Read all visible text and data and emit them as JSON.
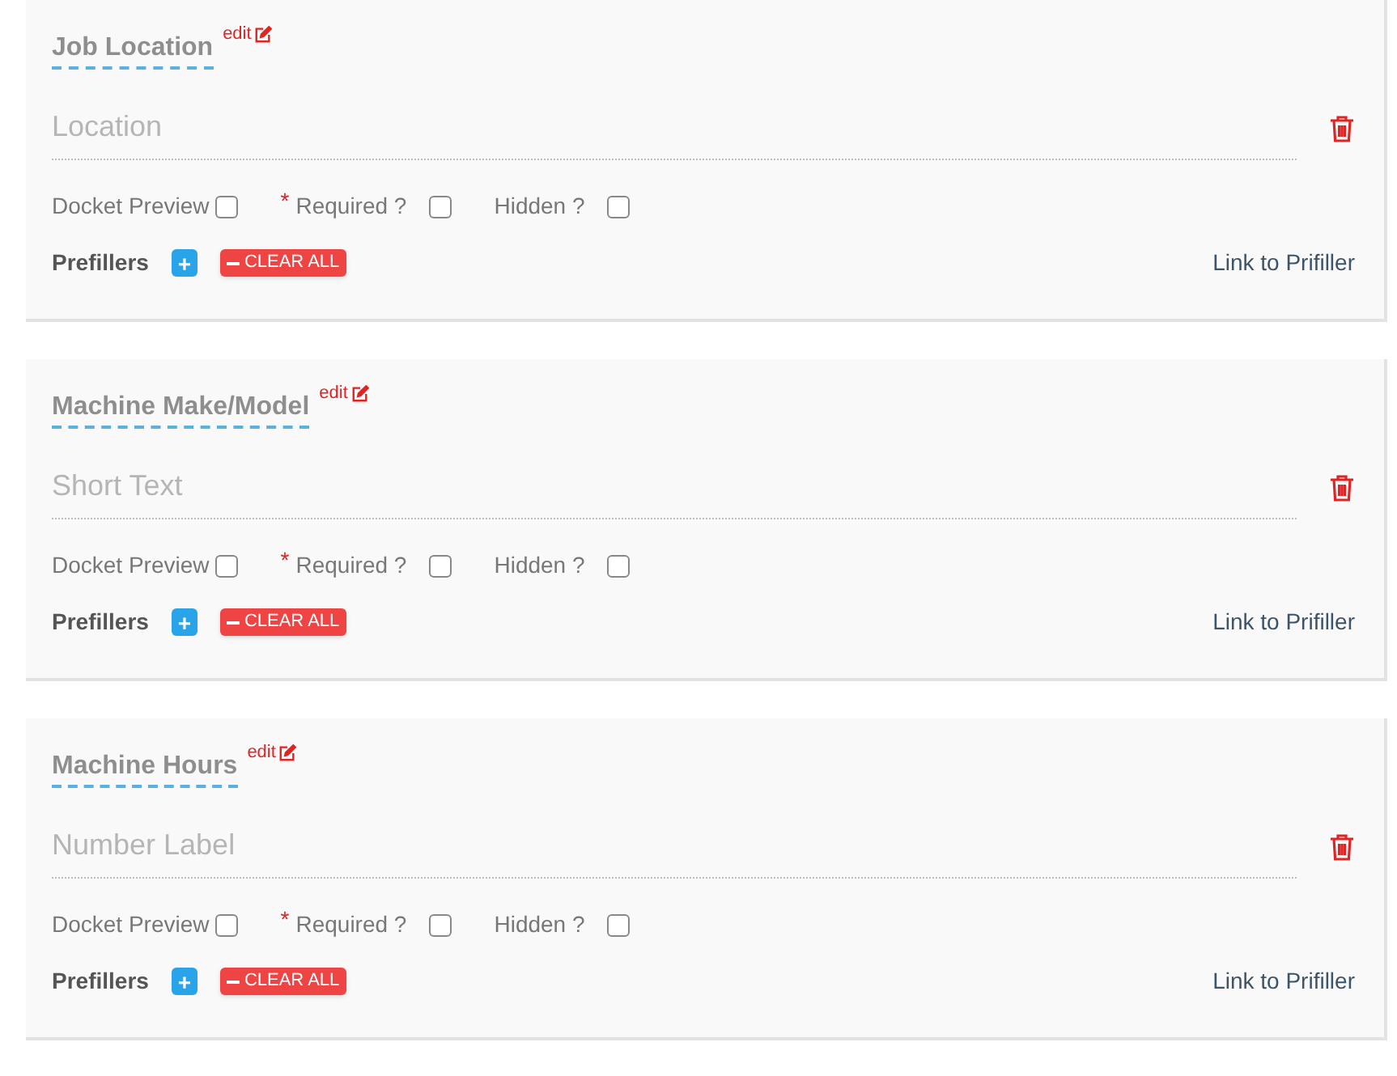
{
  "fields": [
    {
      "title": "Job Location",
      "edit_label": "edit",
      "placeholder": "Location",
      "options": [
        {
          "label": "Docket Preview",
          "checked": false
        },
        {
          "mark": "*",
          "label": "Required ?",
          "checked": false
        },
        {
          "label": "Hidden ?",
          "checked": false
        }
      ],
      "prefillers_label": "Prefillers",
      "add_label": "+",
      "clear_label": "CLEAR ALL",
      "link": "Link to Prifiller"
    },
    {
      "title": "Machine Make/Model",
      "edit_label": "edit",
      "placeholder": "Short Text",
      "options": [
        {
          "label": "Docket Preview",
          "checked": false
        },
        {
          "mark": "*",
          "label": "Required ?",
          "checked": false
        },
        {
          "label": "Hidden ?",
          "checked": false
        }
      ],
      "prefillers_label": "Prefillers",
      "add_label": "+",
      "clear_label": "CLEAR ALL",
      "link": "Link to Prifiller"
    },
    {
      "title": "Machine Hours",
      "edit_label": "edit",
      "placeholder": "Number Label",
      "options": [
        {
          "label": "Docket Preview",
          "checked": false
        },
        {
          "mark": "*",
          "label": "Required ?",
          "checked": false
        },
        {
          "label": "Hidden ?",
          "checked": false
        }
      ],
      "prefillers_label": "Prefillers",
      "add_label": "+",
      "clear_label": "CLEAR ALL",
      "link": "Link to Prifiller"
    }
  ]
}
